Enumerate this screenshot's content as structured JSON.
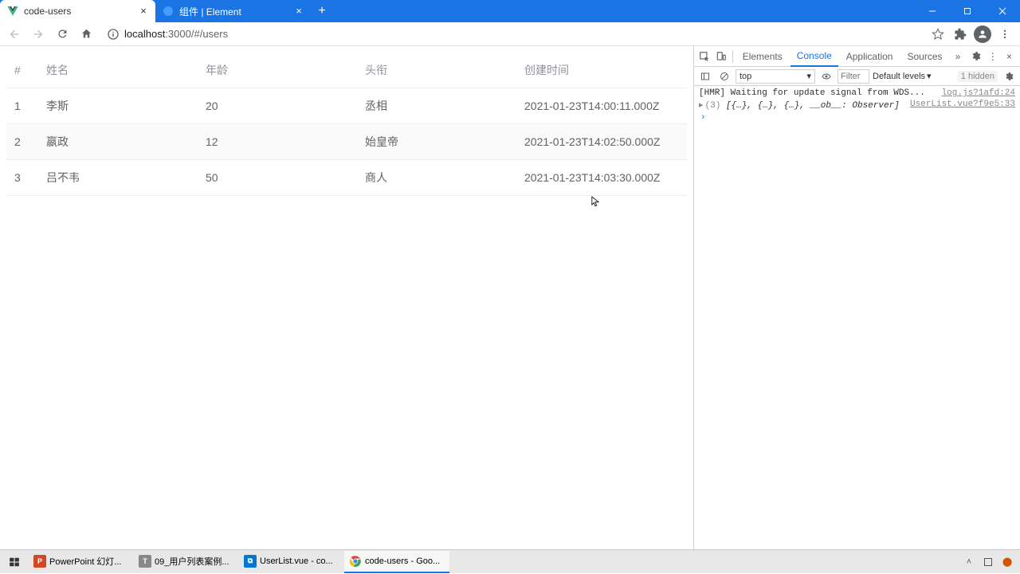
{
  "tabs": [
    {
      "title": "code-users",
      "active": true
    },
    {
      "title": "组件 | Element",
      "active": false
    }
  ],
  "url": {
    "host": "localhost",
    "port": ":3000",
    "path": "/#/users"
  },
  "table": {
    "headers": {
      "idx": "#",
      "name": "姓名",
      "age": "年龄",
      "title": "头衔",
      "created": "创建时间"
    },
    "rows": [
      {
        "idx": "1",
        "name": "李斯",
        "age": "20",
        "title": "丞相",
        "created": "2021-01-23T14:00:11.000Z"
      },
      {
        "idx": "2",
        "name": "嬴政",
        "age": "12",
        "title": "始皇帝",
        "created": "2021-01-23T14:02:50.000Z"
      },
      {
        "idx": "3",
        "name": "吕不韦",
        "age": "50",
        "title": "商人",
        "created": "2021-01-23T14:03:30.000Z"
      }
    ]
  },
  "devtools": {
    "tabs": {
      "elements": "Elements",
      "console": "Console",
      "application": "Application",
      "sources": "Sources"
    },
    "context": "top",
    "filter_placeholder": "Filter",
    "levels": "Default levels",
    "hidden": "1 hidden",
    "msg1": "[HMR] Waiting for update signal from WDS...",
    "src1": "log.js?1afd:24",
    "msg2_prefix": "(3)",
    "msg2_body": " [{…}, {…}, {…}, __ob__: Observer]",
    "src2": "UserList.vue?f9e5:33"
  },
  "taskbar": {
    "items": [
      {
        "label": "PowerPoint 幻灯...",
        "color": "#d24726",
        "char": "P",
        "active": false
      },
      {
        "label": "09_用户列表案例...",
        "color": "#888888",
        "char": "T",
        "active": false
      },
      {
        "label": "UserList.vue - co...",
        "color": "#0078d4",
        "char": "⧉",
        "active": false
      },
      {
        "label": "code-users - Goo...",
        "color": "#ffffff",
        "char": "",
        "active": true,
        "chrome": true
      }
    ]
  }
}
